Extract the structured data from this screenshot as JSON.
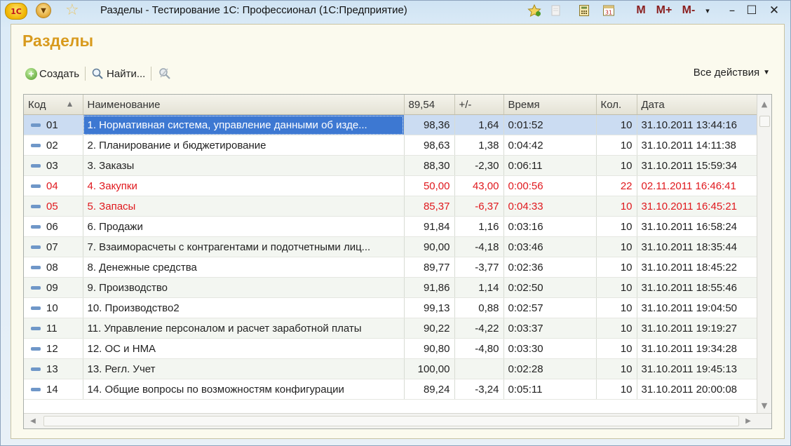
{
  "window": {
    "title": "Разделы - Тестирование 1С: Профессионал  (1С:Предприятие)",
    "logo_text": "1С",
    "toolbar_right": [
      "M",
      "M+",
      "M-"
    ]
  },
  "form": {
    "title": "Разделы",
    "create_label": "Создать",
    "find_label": "Найти...",
    "all_actions_label": "Все действия"
  },
  "table": {
    "columns": [
      "Код",
      "Наименование",
      "89,54",
      "+/-",
      "Время",
      "Кол.",
      "Дата"
    ],
    "rows": [
      {
        "code": "01",
        "name": "1. Нормативная система, управление данными об изде...",
        "score": "98,36",
        "delta": "1,64",
        "time": "0:01:52",
        "count": "10",
        "date": "31.10.2011 13:44:16"
      },
      {
        "code": "02",
        "name": "2. Планирование и бюджетирование",
        "score": "98,63",
        "delta": "1,38",
        "time": "0:04:42",
        "count": "10",
        "date": "31.10.2011 14:11:38"
      },
      {
        "code": "03",
        "name": "3. Заказы",
        "score": "88,30",
        "delta": "-2,30",
        "time": "0:06:11",
        "count": "10",
        "date": "31.10.2011 15:59:34"
      },
      {
        "code": "04",
        "name": "4. Закупки",
        "score": "50,00",
        "delta": "43,00",
        "time": "0:00:56",
        "count": "22",
        "date": "02.11.2011 16:46:41"
      },
      {
        "code": "05",
        "name": "5. Запасы",
        "score": "85,37",
        "delta": "-6,37",
        "time": "0:04:33",
        "count": "10",
        "date": "31.10.2011 16:45:21"
      },
      {
        "code": "06",
        "name": "6. Продажи",
        "score": "91,84",
        "delta": "1,16",
        "time": "0:03:16",
        "count": "10",
        "date": "31.10.2011 16:58:24"
      },
      {
        "code": "07",
        "name": "7. Взаиморасчеты с контрагентами и подотчетными лиц...",
        "score": "90,00",
        "delta": "-4,18",
        "time": "0:03:46",
        "count": "10",
        "date": "31.10.2011 18:35:44"
      },
      {
        "code": "08",
        "name": "8. Денежные средства",
        "score": "89,77",
        "delta": "-3,77",
        "time": "0:02:36",
        "count": "10",
        "date": "31.10.2011 18:45:22"
      },
      {
        "code": "09",
        "name": "9. Производство",
        "score": "91,86",
        "delta": "1,14",
        "time": "0:02:50",
        "count": "10",
        "date": "31.10.2011 18:55:46"
      },
      {
        "code": "10",
        "name": "10. Производство2",
        "score": "99,13",
        "delta": "0,88",
        "time": "0:02:57",
        "count": "10",
        "date": "31.10.2011 19:04:50"
      },
      {
        "code": "11",
        "name": "11. Управление персоналом и расчет заработной платы",
        "score": "90,22",
        "delta": "-4,22",
        "time": "0:03:37",
        "count": "10",
        "date": "31.10.2011 19:19:27"
      },
      {
        "code": "12",
        "name": "12. ОС и НМА",
        "score": "90,80",
        "delta": "-4,80",
        "time": "0:03:30",
        "count": "10",
        "date": "31.10.2011 19:34:28"
      },
      {
        "code": "13",
        "name": "13. Регл. Учет",
        "score": "100,00",
        "delta": "",
        "time": "0:02:28",
        "count": "10",
        "date": "31.10.2011 19:45:13"
      },
      {
        "code": "14",
        "name": "14. Общие вопросы по возможностям конфигурации",
        "score": "89,24",
        "delta": "-3,24",
        "time": "0:05:11",
        "count": "10",
        "date": "31.10.2011 20:00:08"
      }
    ]
  },
  "colors": {
    "title_gold": "#d89a1d",
    "selection_blue": "#3d78d2",
    "highlight_red": "#e0191e"
  }
}
